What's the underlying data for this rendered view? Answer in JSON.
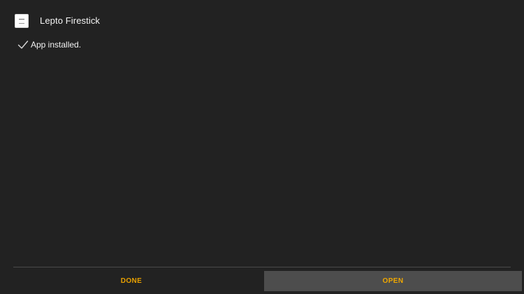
{
  "app": {
    "name": "Lepto Firestick",
    "icon": "lepto-app-icon"
  },
  "status": {
    "icon": "checkmark-icon",
    "text": "App installed."
  },
  "buttons": {
    "done_label": "DONE",
    "open_label": "OPEN"
  },
  "colors": {
    "background": "#222222",
    "accent": "#e8a000",
    "open_button_bg": "#4d4d4d",
    "divider": "#4a4a4a"
  }
}
